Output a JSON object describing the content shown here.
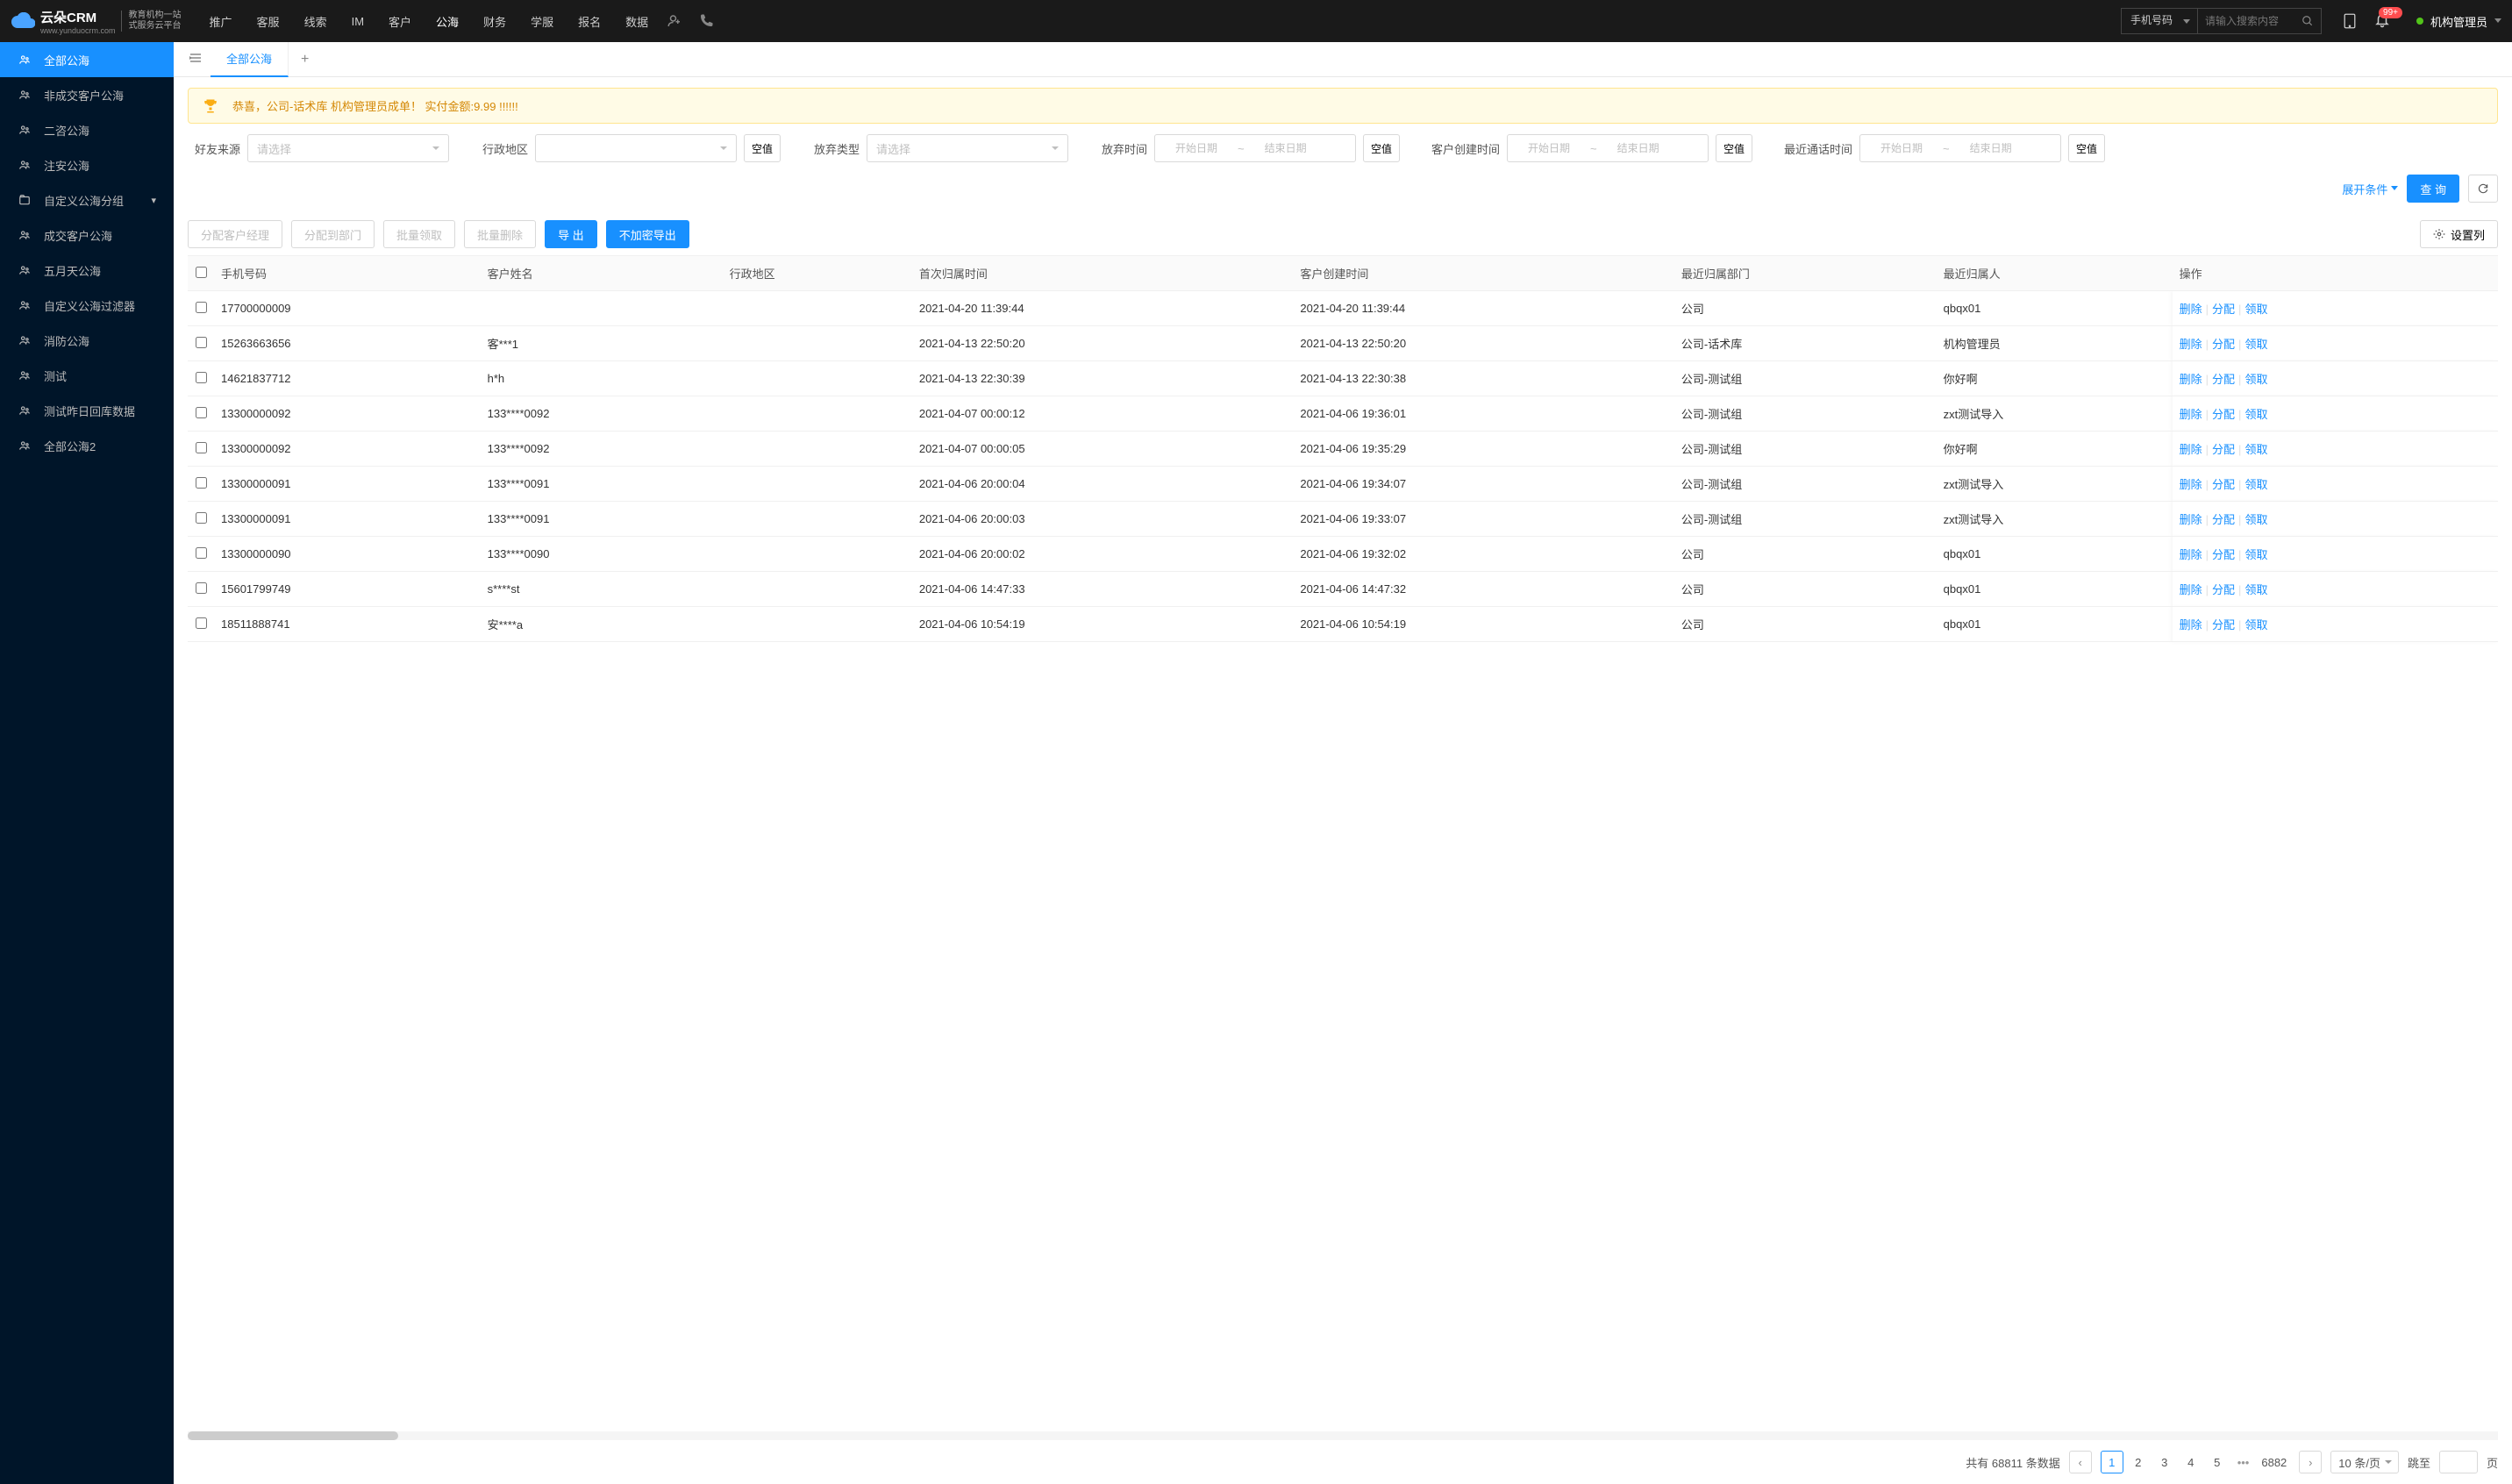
{
  "logo": {
    "main": "云朵CRM",
    "url": "www.yunduocrm.com",
    "sub1": "教育机构一站",
    "sub2": "式服务云平台"
  },
  "nav": {
    "items": [
      "推广",
      "客服",
      "线索",
      "IM",
      "客户",
      "公海",
      "财务",
      "学服",
      "报名",
      "数据"
    ],
    "activeIndex": 5
  },
  "search": {
    "select": "手机号码",
    "placeholder": "请输入搜索内容"
  },
  "notif": {
    "badge": "99+"
  },
  "user": {
    "name": "机构管理员"
  },
  "sidebarItems": [
    {
      "label": "全部公海",
      "icon": "users",
      "active": true
    },
    {
      "label": "非成交客户公海",
      "icon": "users"
    },
    {
      "label": "二咨公海",
      "icon": "users"
    },
    {
      "label": "注安公海",
      "icon": "users"
    },
    {
      "label": "自定义公海分组",
      "icon": "folder",
      "chevron": true
    },
    {
      "label": "成交客户公海",
      "icon": "users"
    },
    {
      "label": "五月天公海",
      "icon": "users"
    },
    {
      "label": "自定义公海过滤器",
      "icon": "users"
    },
    {
      "label": "消防公海",
      "icon": "users"
    },
    {
      "label": "测试",
      "icon": "users"
    },
    {
      "label": "测试昨日回库数据",
      "icon": "users"
    },
    {
      "label": "全部公海2",
      "icon": "users"
    }
  ],
  "tabs": {
    "active": "全部公海"
  },
  "banner": "恭喜，公司-话术库  机构管理员成单！ 实付金额:9.99 !!!!!!",
  "filters": {
    "friendSource": {
      "label": "好友来源",
      "placeholder": "请选择"
    },
    "region": {
      "label": "行政地区",
      "empty": "空值"
    },
    "abandonType": {
      "label": "放弃类型",
      "placeholder": "请选择"
    },
    "abandonTime": {
      "label": "放弃时间",
      "start": "开始日期",
      "end": "结束日期",
      "empty": "空值"
    },
    "createTime": {
      "label": "客户创建时间",
      "start": "开始日期",
      "end": "结束日期",
      "empty": "空值"
    },
    "lastCallTime": {
      "label": "最近通话时间",
      "start": "开始日期",
      "end": "结束日期",
      "empty": "空值"
    },
    "expandLabel": "展开条件",
    "queryBtn": "查 询"
  },
  "toolbar": {
    "assignManager": "分配客户经理",
    "assignDept": "分配到部门",
    "batchClaim": "批量领取",
    "batchDelete": "批量删除",
    "export": "导 出",
    "exportNoEnc": "不加密导出",
    "setCols": "设置列"
  },
  "table": {
    "headers": [
      "手机号码",
      "客户姓名",
      "行政地区",
      "首次归属时间",
      "客户创建时间",
      "最近归属部门",
      "最近归属人",
      "操作"
    ],
    "ops": {
      "delete": "删除",
      "assign": "分配",
      "claim": "领取"
    },
    "rows": [
      {
        "phone": "17700000009",
        "name": "",
        "region": "",
        "firstTime": "2021-04-20 11:39:44",
        "createTime": "2021-04-20 11:39:44",
        "dept": "公司",
        "owner": "qbqx01"
      },
      {
        "phone": "15263663656",
        "name": "客***1",
        "region": "",
        "firstTime": "2021-04-13 22:50:20",
        "createTime": "2021-04-13 22:50:20",
        "dept": "公司-话术库",
        "owner": "机构管理员"
      },
      {
        "phone": "14621837712",
        "name": "h*h",
        "region": "",
        "firstTime": "2021-04-13 22:30:39",
        "createTime": "2021-04-13 22:30:38",
        "dept": "公司-测试组",
        "owner": "你好啊"
      },
      {
        "phone": "13300000092",
        "name": "133****0092",
        "region": "",
        "firstTime": "2021-04-07 00:00:12",
        "createTime": "2021-04-06 19:36:01",
        "dept": "公司-测试组",
        "owner": "zxt测试导入"
      },
      {
        "phone": "13300000092",
        "name": "133****0092",
        "region": "",
        "firstTime": "2021-04-07 00:00:05",
        "createTime": "2021-04-06 19:35:29",
        "dept": "公司-测试组",
        "owner": "你好啊"
      },
      {
        "phone": "13300000091",
        "name": "133****0091",
        "region": "",
        "firstTime": "2021-04-06 20:00:04",
        "createTime": "2021-04-06 19:34:07",
        "dept": "公司-测试组",
        "owner": "zxt测试导入"
      },
      {
        "phone": "13300000091",
        "name": "133****0091",
        "region": "",
        "firstTime": "2021-04-06 20:00:03",
        "createTime": "2021-04-06 19:33:07",
        "dept": "公司-测试组",
        "owner": "zxt测试导入"
      },
      {
        "phone": "13300000090",
        "name": "133****0090",
        "region": "",
        "firstTime": "2021-04-06 20:00:02",
        "createTime": "2021-04-06 19:32:02",
        "dept": "公司",
        "owner": "qbqx01"
      },
      {
        "phone": "15601799749",
        "name": "s****st",
        "region": "",
        "firstTime": "2021-04-06 14:47:33",
        "createTime": "2021-04-06 14:47:32",
        "dept": "公司",
        "owner": "qbqx01"
      },
      {
        "phone": "18511888741",
        "name": "安****a",
        "region": "",
        "firstTime": "2021-04-06 10:54:19",
        "createTime": "2021-04-06 10:54:19",
        "dept": "公司",
        "owner": "qbqx01"
      }
    ]
  },
  "pagination": {
    "totalPrefix": "共有",
    "total": "68811",
    "totalSuffix": "条数据",
    "pages": [
      "1",
      "2",
      "3",
      "4",
      "5"
    ],
    "lastPage": "6882",
    "perPage": "10 条/页",
    "jumpLabel": "跳至",
    "jumpSuffix": "页"
  }
}
